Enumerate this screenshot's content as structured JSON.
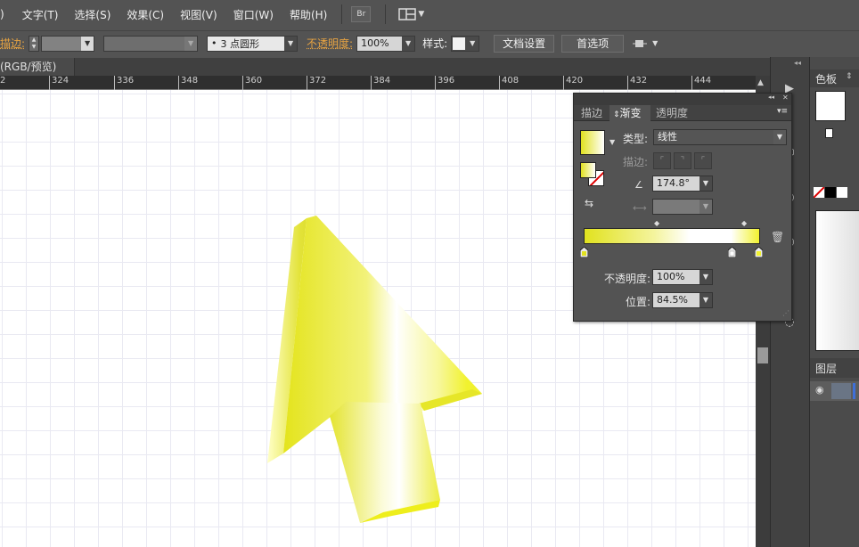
{
  "menubar": {
    "items": [
      ")",
      "文字(T)",
      "选择(S)",
      "效果(C)",
      "视图(V)",
      "窗口(W)",
      "帮助(H)"
    ],
    "bridge_label": "Br"
  },
  "controlbar": {
    "stroke_label": "描边:",
    "brush_value": "3 点圆形",
    "opacity_label": "不透明度:",
    "opacity_value": "100%",
    "style_label": "样式:",
    "doc_setup_button": "文档设置",
    "prefs_button": "首选项"
  },
  "document": {
    "tab_label": "(RGB/预览)"
  },
  "ruler": {
    "ticks": [
      "2",
      "324",
      "336",
      "348",
      "360",
      "372",
      "384",
      "396",
      "408",
      "420",
      "432",
      "444"
    ]
  },
  "right_panels": {
    "swatches_tab": "色板",
    "layers_tab": "图层"
  },
  "gradient_panel": {
    "tabs": [
      "描边",
      "渐变",
      "透明度"
    ],
    "active_tab": 1,
    "type_label": "类型:",
    "type_value": "线性",
    "stroke_label": "描边:",
    "angle_value": "174.8°",
    "opacity_label": "不透明度:",
    "opacity_value": "100%",
    "location_label": "位置:",
    "location_value": "84.5%"
  },
  "colors": {
    "grad_start": "#e1e21f",
    "grad_mid": "#ffffff",
    "grad_end": "#f1f22e"
  }
}
